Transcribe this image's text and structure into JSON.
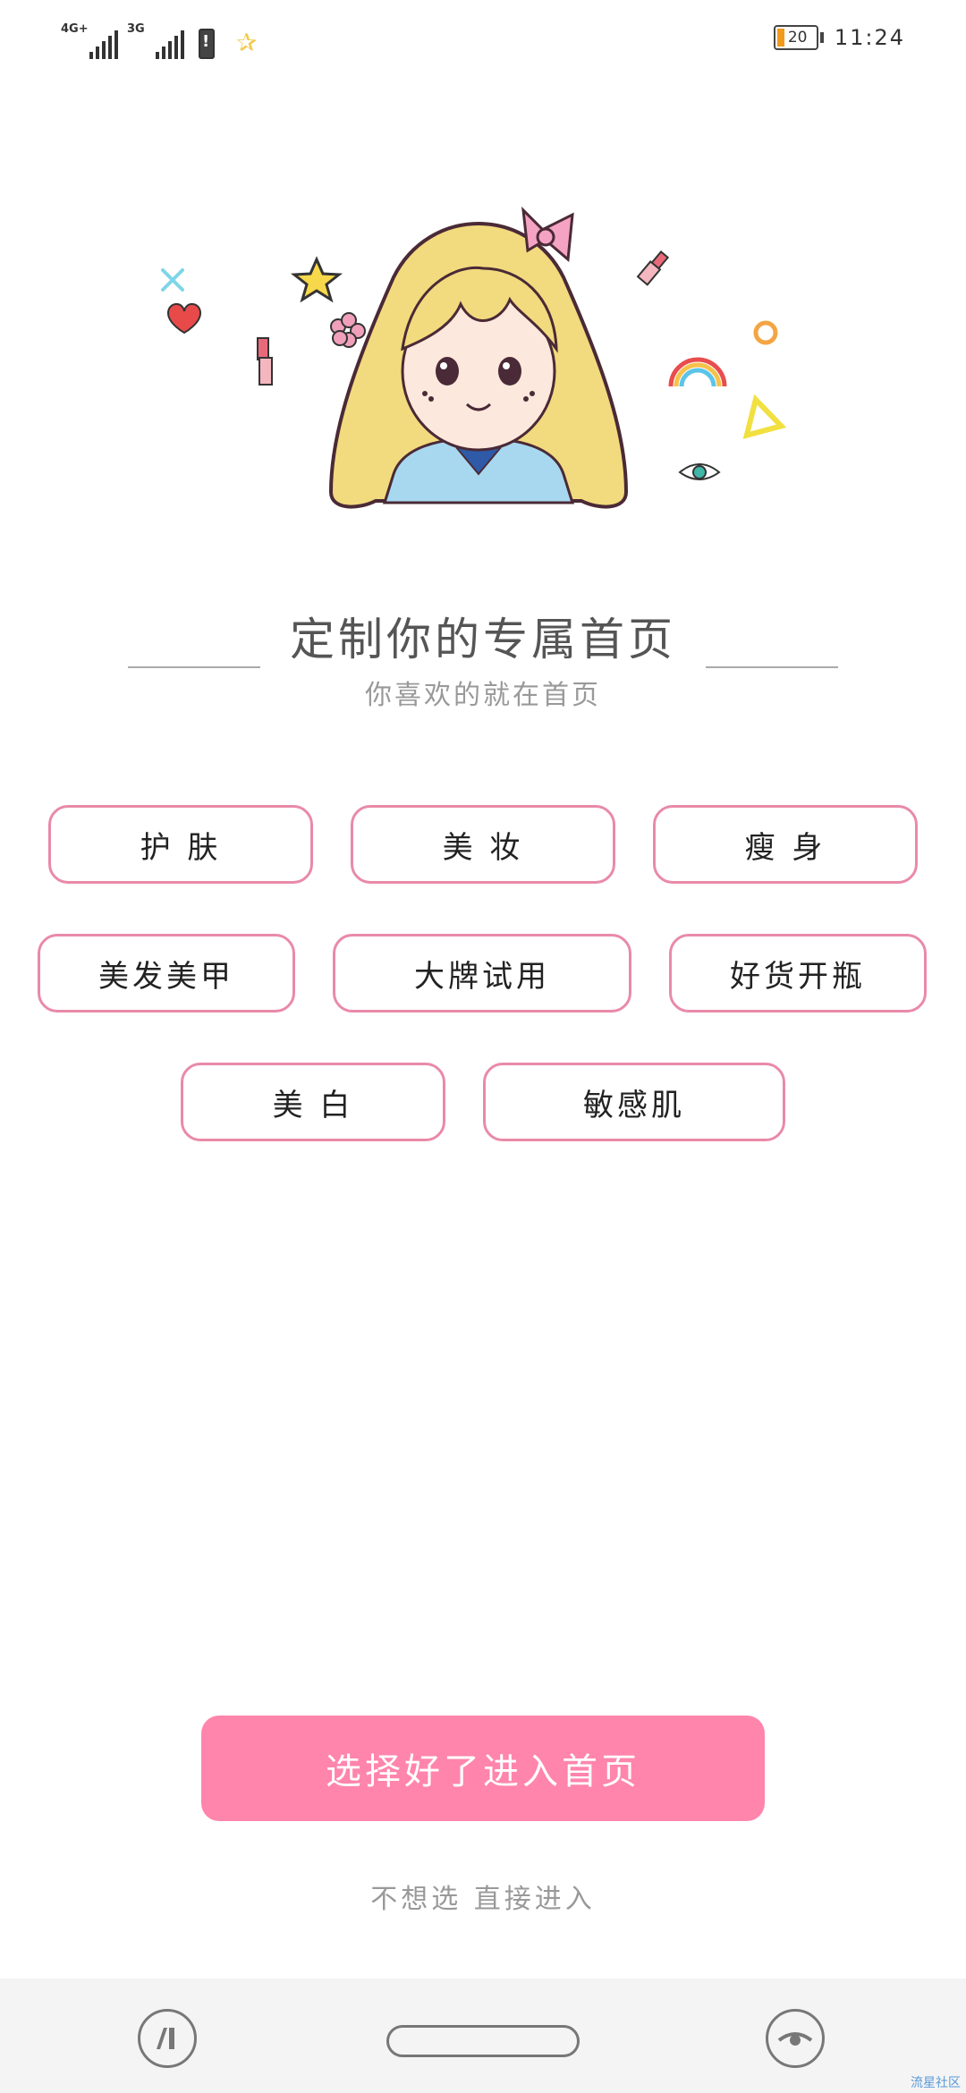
{
  "status_bar": {
    "network_1": "4G+",
    "network_2": "3G",
    "battery_level": "20",
    "time": "11:24"
  },
  "heading": {
    "title": "定制你的专属首页",
    "subtitle": "你喜欢的就在首页"
  },
  "tags": [
    {
      "label": "护 肤"
    },
    {
      "label": "美 妆"
    },
    {
      "label": "瘦 身"
    },
    {
      "label": "美发美甲"
    },
    {
      "label": "大牌试用"
    },
    {
      "label": "好货开瓶"
    },
    {
      "label": "美 白"
    },
    {
      "label": "敏感肌"
    }
  ],
  "cta": {
    "label": "选择好了进入首页"
  },
  "skip": {
    "label": "不想选 直接进入"
  },
  "watermark": "流星社区",
  "colors": {
    "accent": "#ff85ad",
    "tag_border": "#e98aa8",
    "title_text": "#555555",
    "subtitle_text": "#999999"
  },
  "icons": [
    "signal-icon",
    "battery-alert-icon",
    "star-icon",
    "battery-icon",
    "nav-recent-icon",
    "nav-home-pill",
    "nav-eye-icon"
  ]
}
